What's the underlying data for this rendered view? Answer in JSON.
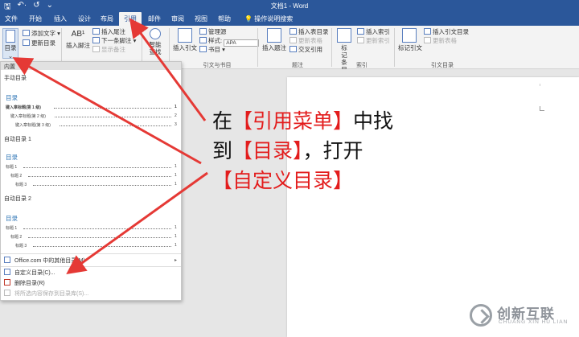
{
  "window": {
    "title": "文档1 - Word"
  },
  "qat": {
    "save": "🖫",
    "undo": "↶·",
    "redo": "↺",
    "more": "⌄"
  },
  "tabs": [
    "文件",
    "开始",
    "插入",
    "设计",
    "布局",
    "引用",
    "邮件",
    "审阅",
    "视图",
    "帮助",
    "操作说明搜索"
  ],
  "tell_me_icon": "lightbulb-icon",
  "ribbon": {
    "toc": {
      "label": "目录",
      "caret": "⌄"
    },
    "add_text": "添加文字 ▾",
    "update_toc": "更新目录",
    "footnote_big": "插入脚注",
    "footnote_ab": "AB¹",
    "insert_endnote": "插入尾注",
    "next_footnote": "下一条脚注 ▾",
    "show_notes": "显示备注",
    "smart_lookup": "智能查找",
    "insert_citation": "插入引文",
    "manage_sources": "管理源",
    "style_label": "样式:",
    "style_value": "APA",
    "bibliography": "书目 ▾",
    "insert_caption": "插入题注",
    "insert_table_of_figures": "插入表目录",
    "update_table": "更新表格",
    "cross_reference": "交叉引用",
    "mark_entry": "标记条目",
    "insert_index": "插入索引",
    "update_index": "更新索引",
    "mark_citation": "标记引文",
    "insert_table_of_authorities": "插入引文目录",
    "update_table_2": "更新表格",
    "groups": {
      "citations": "引文与书目",
      "captions": "题注",
      "index": "索引",
      "authorities": "引文目录"
    }
  },
  "gallery": {
    "header": "内置",
    "manual_label": "手动目录",
    "manual": {
      "title": "目录",
      "lines": [
        {
          "text": "键入章标题(第 1 级)",
          "num": "1"
        },
        {
          "text": "键入章标题(第 2 级)",
          "num": "2"
        },
        {
          "text": "键入章标题(第 3 级)",
          "num": "3"
        }
      ]
    },
    "auto1_label": "自动目录 1",
    "auto1": {
      "title": "目录",
      "lines": [
        {
          "text": "标题 1",
          "num": "1"
        },
        {
          "text": "标题 2",
          "num": "1"
        },
        {
          "text": "标题 3",
          "num": "1"
        }
      ]
    },
    "auto2_label": "自动目录 2",
    "auto2": {
      "title": "目录",
      "lines": [
        {
          "text": "标题 1",
          "num": "1"
        },
        {
          "text": "标题 2",
          "num": "1"
        },
        {
          "text": "标题 3",
          "num": "1"
        }
      ]
    },
    "menu": {
      "office_more": "Office.com 中的其他目录(M)",
      "office_more_arrow": "▸",
      "custom_toc": "自定义目录(C)...",
      "remove_toc": "删除目录(R)",
      "save_selection": "将所选内容保存到目录库(S)..."
    }
  },
  "annotation": {
    "line1_a": "在",
    "line1_b": "【引用菜单】",
    "line1_c": "中找",
    "line2_a": "到",
    "line2_b": "【目录】",
    "line2_c": "，打开",
    "line3_b": "【自定义目录】"
  },
  "watermark": {
    "name": "创新互联",
    "sub": "CHUANG XIN HU LIAN"
  },
  "colors": {
    "word_blue": "#2b579a",
    "arrow_red": "#e53935",
    "annotation_red": "#e31d1d"
  }
}
